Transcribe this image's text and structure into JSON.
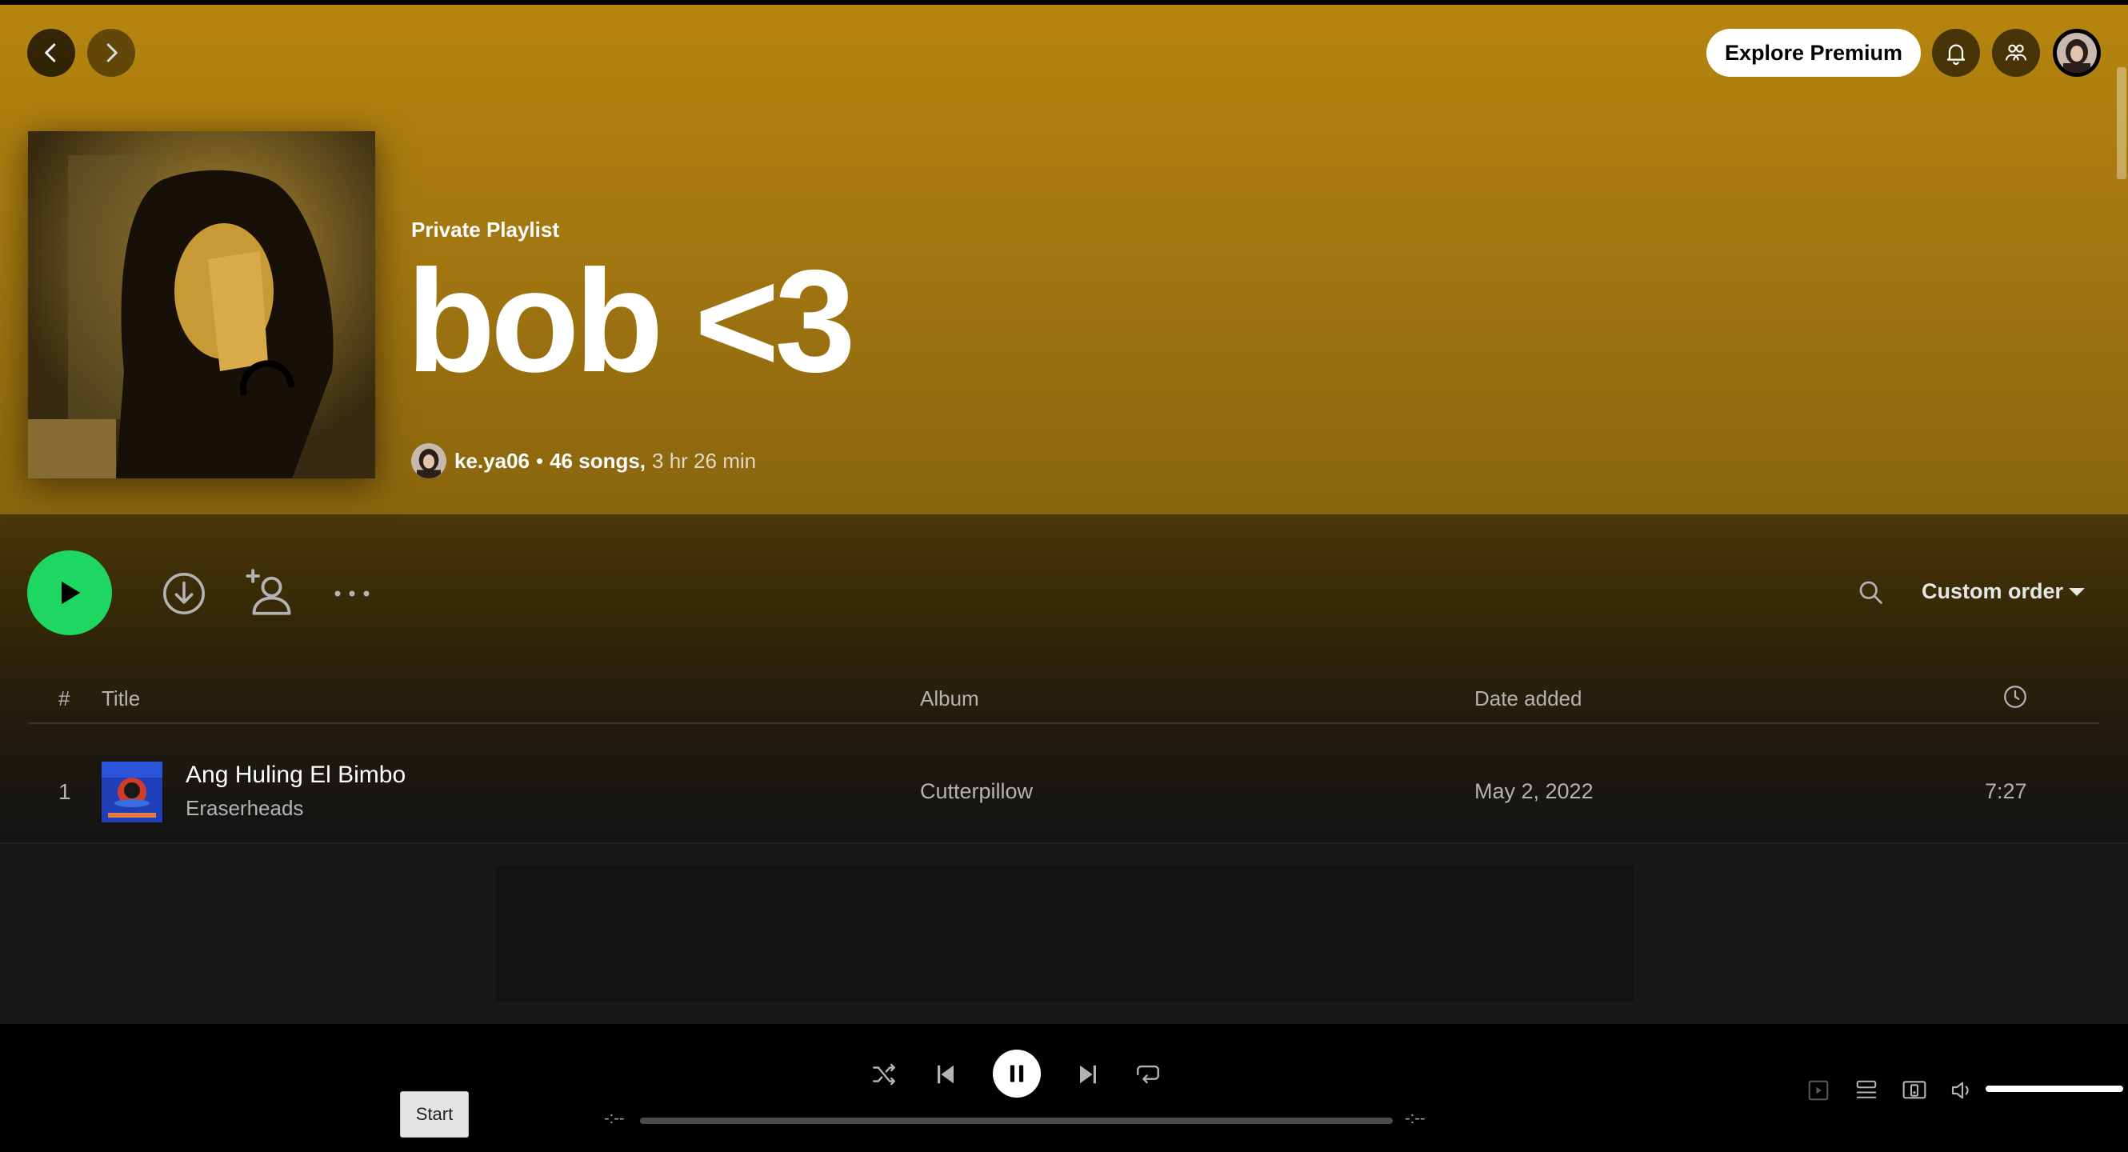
{
  "header": {
    "explore_premium": "Explore Premium",
    "playlist_type": "Private Playlist",
    "playlist_title": "bob <3",
    "owner": "ke.ya06",
    "separator": "•",
    "song_count": "46 songs,",
    "duration": "3 hr 26 min"
  },
  "controls": {
    "sort_label": "Custom order"
  },
  "table": {
    "headers": {
      "number": "#",
      "title": "Title",
      "album": "Album",
      "date_added": "Date added"
    },
    "rows": [
      {
        "number": "1",
        "title": "Ang Huling El Bimbo",
        "artist": "Eraserheads",
        "album": "Cutterpillow",
        "date_added": "May 2, 2022",
        "duration": "7:27"
      }
    ]
  },
  "player": {
    "time_elapsed": "-:--",
    "time_total": "-:--",
    "volume_level": 1.0
  },
  "tooltip": {
    "text": "Start"
  },
  "colors": {
    "header_accent": "#b6850f",
    "play_green": "#1ed760",
    "background": "#121212"
  },
  "icons": {
    "back": "chevron-left-icon",
    "forward": "chevron-right-icon",
    "notifications": "bell-icon",
    "friends": "friends-icon",
    "download": "download-icon",
    "add_user": "add-user-icon",
    "more": "more-icon",
    "search": "search-icon",
    "clock": "clock-icon",
    "shuffle": "shuffle-icon",
    "repeat": "repeat-icon"
  }
}
